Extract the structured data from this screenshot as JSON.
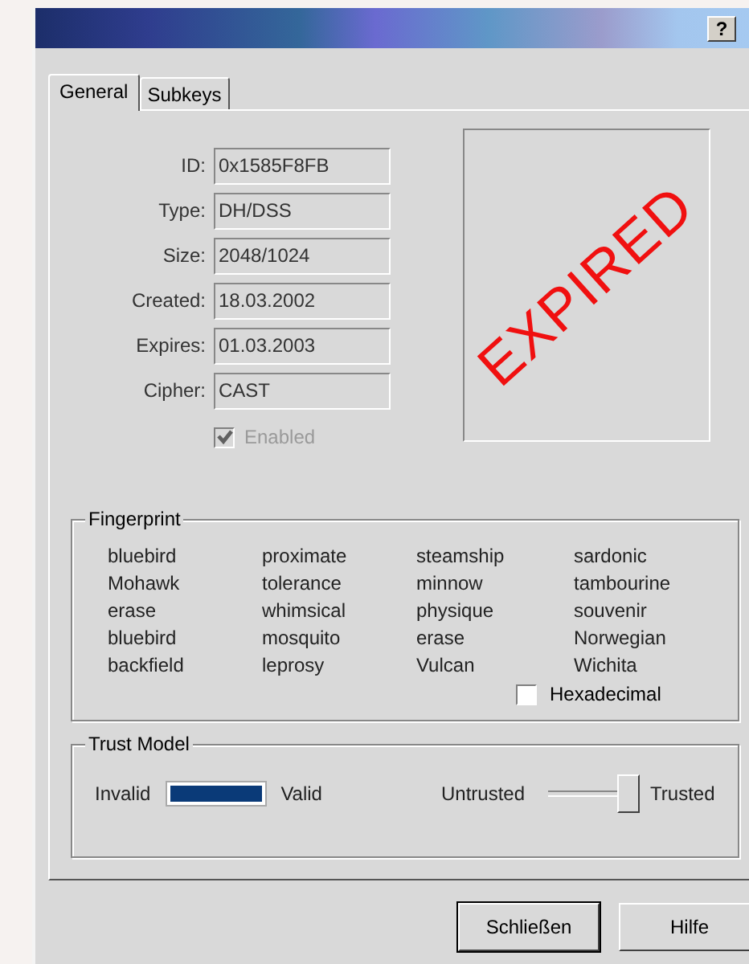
{
  "title_bar": {
    "help_button": "?"
  },
  "tabs": [
    {
      "label": "General",
      "selected": true
    },
    {
      "label": "Subkeys",
      "selected": false
    }
  ],
  "fields": [
    {
      "label": "ID:",
      "value": "0x1585F8FB"
    },
    {
      "label": "Type:",
      "value": "DH/DSS"
    },
    {
      "label": "Size:",
      "value": "2048/1024"
    },
    {
      "label": "Created:",
      "value": "18.03.2002"
    },
    {
      "label": "Expires:",
      "value": "01.03.2003"
    },
    {
      "label": "Cipher:",
      "value": "CAST"
    }
  ],
  "enabled": {
    "label": "Enabled",
    "checked": true,
    "disabled": true
  },
  "stamp": "EXPIRED",
  "fingerprint": {
    "title": "Fingerprint",
    "words": [
      "bluebird",
      "proximate",
      "steamship",
      "sardonic",
      "Mohawk",
      "tolerance",
      "minnow",
      "tambourine",
      "erase",
      "whimsical",
      "physique",
      "souvenir",
      "bluebird",
      "mosquito",
      "erase",
      "Norwegian",
      "backfield",
      "leprosy",
      "Vulcan",
      "Wichita"
    ],
    "hexadecimal": {
      "label": "Hexadecimal",
      "checked": false
    }
  },
  "trust_model": {
    "title": "Trust Model",
    "validity": {
      "low_label": "Invalid",
      "high_label": "Valid",
      "level": 1
    },
    "trust": {
      "low_label": "Untrusted",
      "high_label": "Trusted",
      "level": 1
    }
  },
  "buttons": [
    "Schließen",
    "Hilfe"
  ]
}
